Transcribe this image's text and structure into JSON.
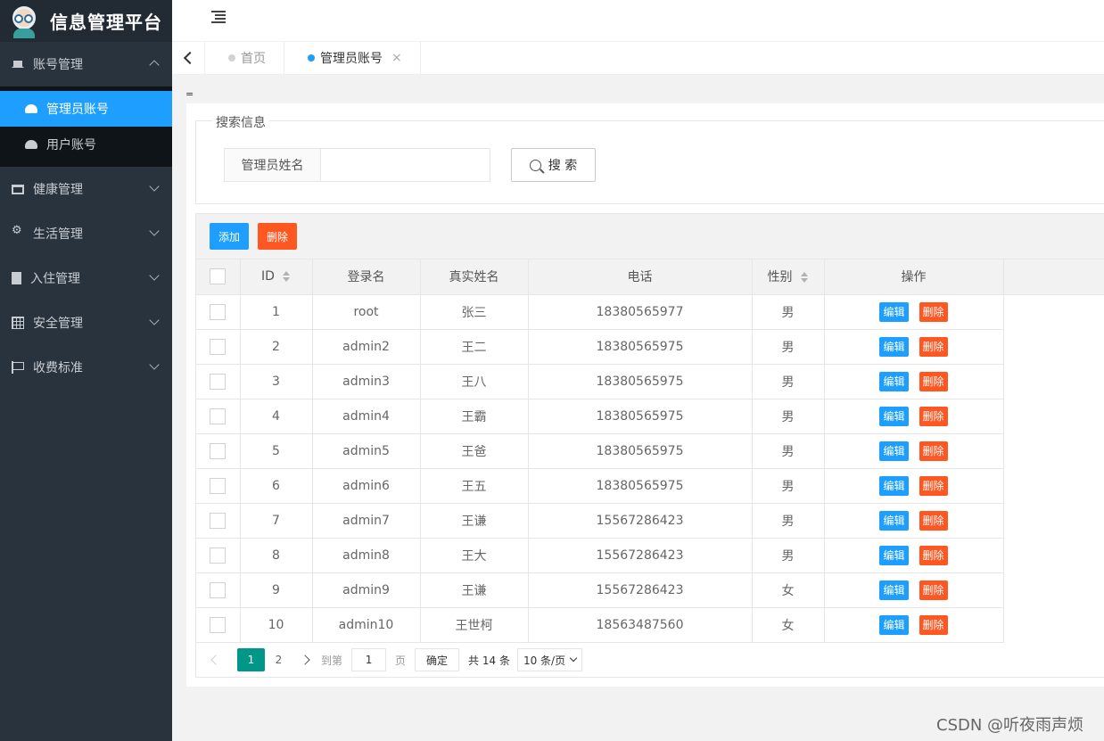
{
  "brand": {
    "title": "信息管理平台"
  },
  "sidebar": {
    "items": [
      {
        "label": "账号管理",
        "icon": "home-icon",
        "expanded": true,
        "children": [
          {
            "label": "管理员账号",
            "icon": "dashboard-icon",
            "active": true
          },
          {
            "label": "用户账号",
            "icon": "dashboard-icon",
            "active": false
          }
        ]
      },
      {
        "label": "健康管理",
        "icon": "window-icon",
        "expanded": false
      },
      {
        "label": "生活管理",
        "icon": "gears-icon",
        "expanded": false
      },
      {
        "label": "入住管理",
        "icon": "document-icon",
        "expanded": false
      },
      {
        "label": "安全管理",
        "icon": "calendar-icon",
        "expanded": false
      },
      {
        "label": "收费标准",
        "icon": "flag-icon",
        "expanded": false
      }
    ]
  },
  "tabs": [
    {
      "label": "首页",
      "active": false
    },
    {
      "label": "管理员账号",
      "active": true,
      "close": "×"
    }
  ],
  "page_marker": "=",
  "search": {
    "legend": "搜索信息",
    "field_label": "管理员姓名",
    "value": "",
    "button": "搜 索"
  },
  "toolbar": {
    "add": "添加",
    "delete": "删除"
  },
  "table": {
    "columns": [
      "ID",
      "登录名",
      "真实姓名",
      "电话",
      "性别",
      "操作"
    ],
    "row_actions": {
      "edit": "编辑",
      "delete": "删除"
    },
    "rows": [
      [
        "1",
        "root",
        "张三",
        "18380565977",
        "男"
      ],
      [
        "2",
        "admin2",
        "王二",
        "18380565975",
        "男"
      ],
      [
        "3",
        "admin3",
        "王八",
        "18380565975",
        "男"
      ],
      [
        "4",
        "admin4",
        "王霸",
        "18380565975",
        "男"
      ],
      [
        "5",
        "admin5",
        "王爸",
        "18380565975",
        "男"
      ],
      [
        "6",
        "admin6",
        "王五",
        "18380565975",
        "男"
      ],
      [
        "7",
        "admin7",
        "王谦",
        "15567286423",
        "男"
      ],
      [
        "8",
        "admin8",
        "王大",
        "15567286423",
        "男"
      ],
      [
        "9",
        "admin9",
        "王谦",
        "15567286423",
        "女"
      ],
      [
        "10",
        "admin10",
        "王世柯",
        "18563487560",
        "女"
      ]
    ]
  },
  "pager": {
    "pages": [
      "1",
      "2"
    ],
    "current": "1",
    "goto_prefix": "到第",
    "goto_value": "1",
    "goto_suffix": "页",
    "confirm": "确定",
    "total": "共 14 条",
    "page_size": "10 条/页"
  },
  "watermark": "CSDN @听夜雨声烦",
  "colors": {
    "primary": "#1e9fff",
    "danger": "#ff5722",
    "pager_active": "#009688",
    "sidebar": "#28333e"
  }
}
